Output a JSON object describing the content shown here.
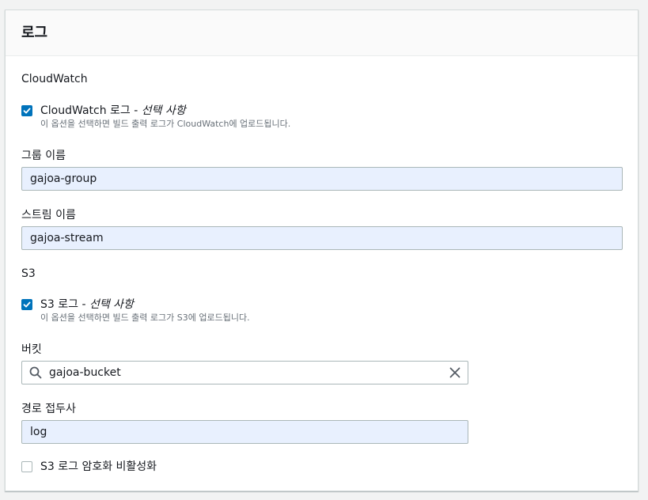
{
  "panel": {
    "title": "로그"
  },
  "cloudwatch": {
    "section_label": "CloudWatch",
    "checkbox": {
      "label": "CloudWatch 로그 - ",
      "optional": "선택 사항",
      "description": "이 옵션을 선택하면 빌드 출력 로그가 CloudWatch에 업로드됩니다.",
      "checked": true
    },
    "group_name": {
      "label": "그룹 이름",
      "value": "gajoa-group"
    },
    "stream_name": {
      "label": "스트림 이름",
      "value": "gajoa-stream"
    }
  },
  "s3": {
    "section_label": "S3",
    "checkbox": {
      "label": "S3 로그 - ",
      "optional": "선택 사항",
      "description": "이 옵션을 선택하면 빌드 출력 로그가 S3에 업로드됩니다.",
      "checked": true
    },
    "bucket": {
      "label": "버킷",
      "value": "gajoa-bucket"
    },
    "path_prefix": {
      "label": "경로 접두사",
      "value": "log"
    },
    "disable_encryption": {
      "label": "S3 로그 암호화 비활성화",
      "checked": false
    }
  },
  "colors": {
    "accent": "#0073bb",
    "autofill_bg": "#e8f0fe",
    "border": "#aab7b8"
  },
  "icons": {
    "search": "search-icon",
    "clear": "close-icon",
    "check": "checkmark-icon"
  }
}
